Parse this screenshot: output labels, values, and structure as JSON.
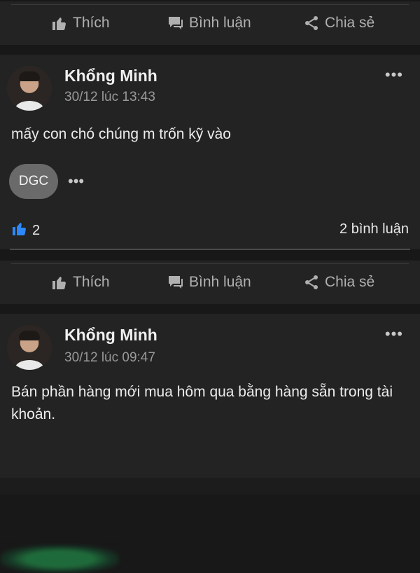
{
  "actions": {
    "like": "Thích",
    "comment": "Bình luận",
    "share": "Chia sẻ"
  },
  "posts": [
    {
      "author": "Khổng Minh",
      "timestamp": "30/12 lúc 13:43",
      "text": "mấy con chó chúng m trốn kỹ vào",
      "chip": "DGC",
      "likes": "2",
      "comments": "2 bình luận",
      "more": "•••"
    },
    {
      "author": "Khổng Minh",
      "timestamp": "30/12 lúc 09:47",
      "text": "Bán phần hàng mới mua hôm qua bằng hàng sẵn trong tài khoản.",
      "more": "•••"
    }
  ],
  "colors": {
    "like_blue": "#1877f2",
    "accent_green": "#1f6a3a"
  },
  "icons": [
    "thumbs-up-icon",
    "comment-icon",
    "share-icon",
    "more-icon"
  ]
}
